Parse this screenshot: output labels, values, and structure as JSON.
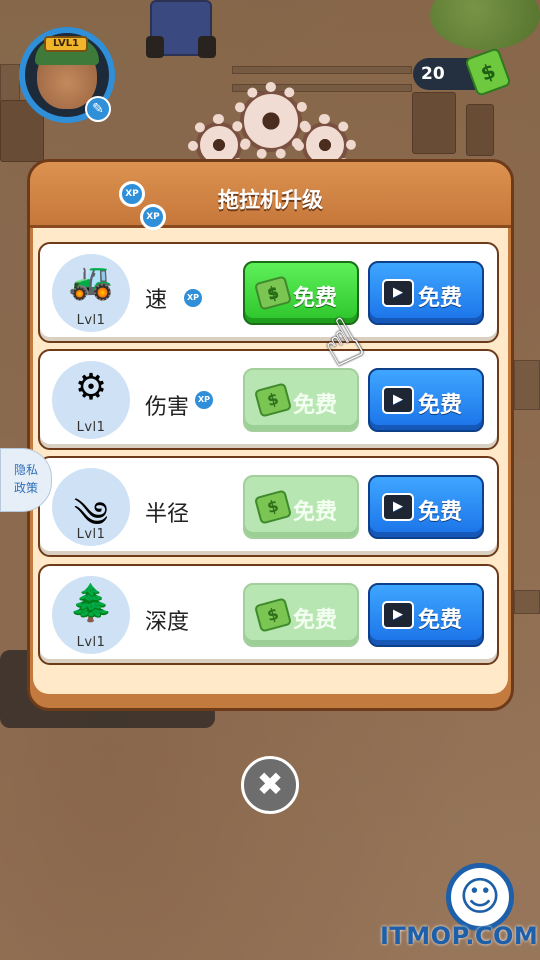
{
  "hud": {
    "player_level": "LVL1",
    "cash_amount": "20"
  },
  "panel": {
    "title": "拖拉机升级",
    "xp_tag": "XP"
  },
  "upgrades": [
    {
      "label": "速",
      "icon": "tractor-icon",
      "level": "Lvl1",
      "has_xp": true,
      "cash_label": "免费",
      "cash_active": true,
      "video_label": "免费"
    },
    {
      "label": "伤害",
      "icon": "saw-blade-icon",
      "level": "Lvl1",
      "has_xp": true,
      "cash_label": "免费",
      "cash_active": false,
      "video_label": "免费"
    },
    {
      "label": "半径",
      "icon": "radius-icon",
      "level": "Lvl1",
      "has_xp": false,
      "cash_label": "免费",
      "cash_active": false,
      "video_label": "免费"
    },
    {
      "label": "深度",
      "icon": "forest-depth-icon",
      "level": "Lvl1",
      "has_xp": false,
      "cash_label": "免费",
      "cash_active": false,
      "video_label": "免费"
    }
  ],
  "privacy": {
    "line1": "隐私",
    "line2": "政策"
  },
  "close_symbol": "✖",
  "watermark": "ITMOP.COM",
  "colors": {
    "panel_border": "#6d3a1a",
    "panel_header": "#dc9250",
    "panel_body": "#ffe9c9",
    "cash_button_active": "#2cc42a",
    "cash_button_disabled": "#b8e6b2",
    "video_button": "#1a72e8",
    "xp_badge": "#2f8fd8"
  }
}
